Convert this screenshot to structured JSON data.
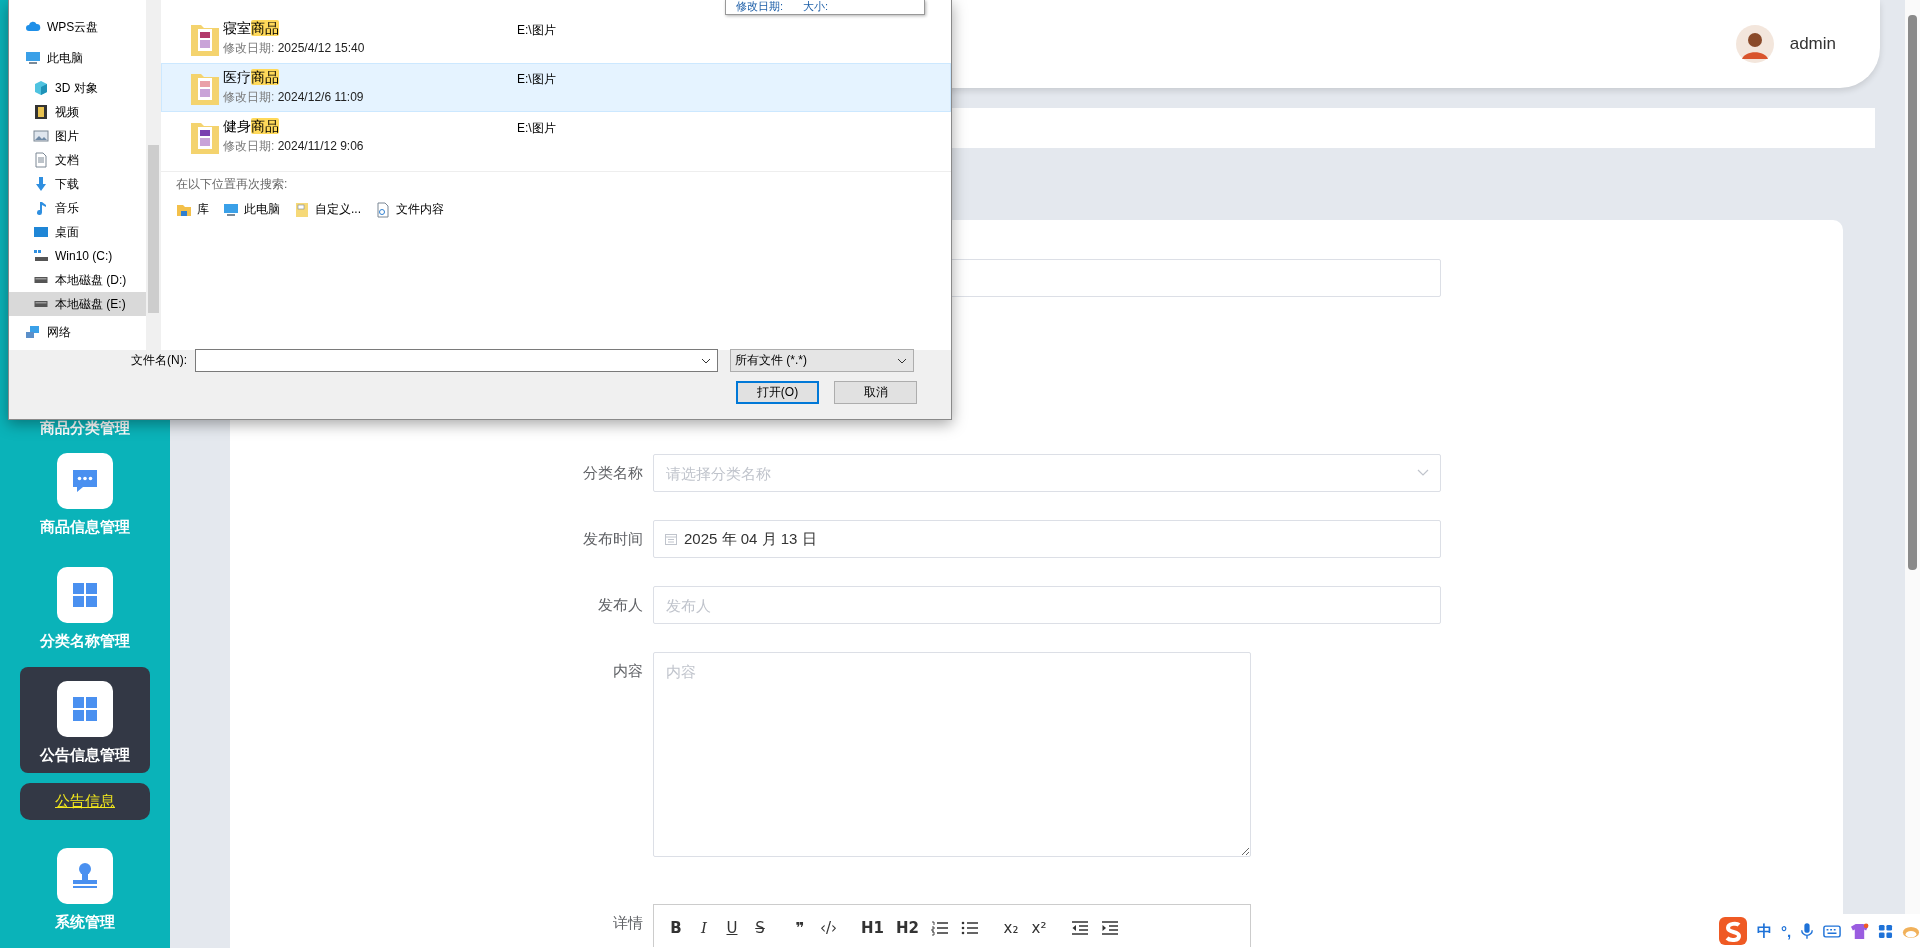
{
  "sidebar": {
    "items": [
      {
        "label": "商品分类管理",
        "kind": "text",
        "selected": false
      },
      {
        "label": "商品信息管理",
        "kind": "chat",
        "selected": false
      },
      {
        "label": "分类名称管理",
        "kind": "grid",
        "selected": false
      },
      {
        "label": "公告信息管理",
        "kind": "grid",
        "selected": true,
        "children": [
          {
            "label": "公告信息",
            "selected": true
          }
        ]
      },
      {
        "label": "系统管理",
        "kind": "stamp",
        "selected": false
      }
    ]
  },
  "header": {
    "user": "admin"
  },
  "form": {
    "fields": [
      {
        "kind": "input"
      },
      {
        "label": "分类名称",
        "kind": "select",
        "placeholder": "请选择分类名称"
      },
      {
        "label": "发布时间",
        "kind": "date",
        "value": "2025 年 04 月 13 日"
      },
      {
        "label": "发布人",
        "kind": "input",
        "placeholder": "发布人"
      },
      {
        "label": "内容",
        "kind": "textarea",
        "placeholder": "内容"
      },
      {
        "label": "详情",
        "kind": "editor",
        "tools": [
          {
            "kind": "bold",
            "text": "B"
          },
          {
            "kind": "italic",
            "text": "I"
          },
          {
            "kind": "underline",
            "text": "U"
          },
          {
            "kind": "strike",
            "text": "S"
          },
          {
            "kind": "quote",
            "text": "❞"
          },
          {
            "kind": "code",
            "text": "‹/›"
          },
          {
            "kind": "heading",
            "text": "H1"
          },
          {
            "kind": "heading",
            "text": "H2"
          },
          {
            "kind": "ordered-list"
          },
          {
            "kind": "bullet-list"
          },
          {
            "kind": "script",
            "text": "x₂"
          },
          {
            "kind": "script",
            "text": "x²"
          },
          {
            "kind": "outdent"
          },
          {
            "kind": "indent"
          }
        ]
      }
    ]
  },
  "file_dialog": {
    "tooltip": [
      "修改日期:",
      "大小:"
    ],
    "nav": [
      {
        "label": "WPS云盘",
        "kind": "cloud",
        "selected": false
      },
      {
        "label": "此电脑",
        "kind": "pc",
        "selected": false,
        "children": [
          {
            "label": "3D 对象",
            "kind": "cube",
            "selected": false
          },
          {
            "label": "视频",
            "kind": "film",
            "selected": false
          },
          {
            "label": "图片",
            "kind": "picture",
            "selected": false
          },
          {
            "label": "文档",
            "kind": "doc",
            "selected": false
          },
          {
            "label": "下载",
            "kind": "download",
            "selected": false
          },
          {
            "label": "音乐",
            "kind": "music",
            "selected": false
          },
          {
            "label": "桌面",
            "kind": "desktop",
            "selected": false
          },
          {
            "label": "Win10 (C:)",
            "kind": "windrive",
            "selected": false
          },
          {
            "label": "本地磁盘 (D:)",
            "kind": "drive",
            "selected": false
          },
          {
            "label": "本地磁盘 (E:)",
            "kind": "drive",
            "selected": true
          }
        ]
      },
      {
        "label": "网络",
        "kind": "network",
        "selected": false
      }
    ],
    "results": [
      {
        "name": "寝室",
        "match": "商品",
        "modified_label": "修改日期:",
        "modified": "2025/4/12 15:40",
        "location": "E:\\图片",
        "selected": false
      },
      {
        "name": "医疗",
        "match": "商品",
        "modified_label": "修改日期:",
        "modified": "2024/12/6 11:09",
        "location": "E:\\图片",
        "selected": true
      },
      {
        "name": "健身",
        "match": "商品",
        "modified_label": "修改日期:",
        "modified": "2024/11/12 9:06",
        "location": "E:\\图片",
        "selected": false
      }
    ],
    "search_again": {
      "title": "在以下位置再次搜索:",
      "locations": [
        {
          "label": "库",
          "kind": "library"
        },
        {
          "label": "此电脑",
          "kind": "pc"
        },
        {
          "label": "自定义...",
          "kind": "custom"
        },
        {
          "label": "文件内容",
          "kind": "content"
        }
      ]
    },
    "file_name_label": "文件名(N):",
    "file_type": "所有文件 (*.*)",
    "buttons": [
      {
        "label": "打开(O)",
        "default": true
      },
      {
        "label": "取消",
        "default": false
      }
    ]
  },
  "ime": {
    "mode": "中",
    "punctuation": "°,"
  }
}
